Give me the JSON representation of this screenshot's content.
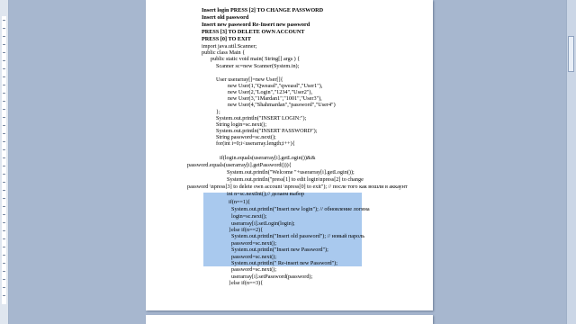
{
  "document": {
    "lines": [
      {
        "text": "Insert login PRESS [2] TO CHANGE PASSWORD",
        "bold": true
      },
      {
        "text": "Insert old password",
        "bold": true
      },
      {
        "text": "Insert new password Re-Insert new password",
        "bold": true
      },
      {
        "text": "PRESS [3] TO DELETE OWN ACCOUNT",
        "bold": true
      },
      {
        "text": "PRESS [0] TO EXIT",
        "bold": true
      },
      {
        "text": "import java.util.Scanner;",
        "bold": false
      },
      {
        "text": "public class Main {",
        "bold": false
      },
      {
        "text": "public static void main( String[] args ) {",
        "bold": false
      },
      {
        "text": "Scanner sc=new Scanner(System.in);",
        "bold": false
      },
      {
        "text": "User userarray[]=new User[]{",
        "bold": false
      },
      {
        "text": "new User(1,\"Qweasd\",\"qweasd\",\"User1\"),",
        "bold": false
      },
      {
        "text": "new User(2,\"Login\",\"1234\",\"User2\"),",
        "bold": false
      },
      {
        "text": "new User(3,\"1Mardan1\",\"1001\",\"User3\"),",
        "bold": false
      },
      {
        "text": "new User(4,\"Shahmardan\",\"password\",\"User4\")",
        "bold": false
      },
      {
        "text": "};",
        "bold": false
      },
      {
        "text": "System.out.println(\"INSERT LOGIN:\");",
        "bold": false
      },
      {
        "text": "String login=sc.next();",
        "bold": false
      },
      {
        "text": "System.out.println(\"INSERT PASSWORD\");",
        "bold": false
      },
      {
        "text": "String password=sc.next();",
        "bold": false
      },
      {
        "text": "for(int i=0;i<userarray.length;i++){",
        "bold": false
      },
      {
        "text": "if(login.equals(userarray[i].getLogin())&&",
        "bold": false
      },
      {
        "text": "password.equals(userarray[i].getPassword())){",
        "bold": false
      },
      {
        "text": "System.out.println(\"Welcome \"+userarray[i].getLogin());",
        "bold": false
      },
      {
        "text": "System.out.println(\"press[1] to edit login\\npress[2] to change",
        "bold": false
      },
      {
        "text": "password \\npress[3] to delete own account \\npress[0] to exit\"); // после того как вошли в аккаунт",
        "bold": false
      },
      {
        "text": "int n=sc.nextInt();// делаем выбор",
        "bold": false
      },
      {
        "text": "if(n==1){",
        "bold": false
      },
      {
        "text": "System.out.println(\"Insert new login\"); // обновление логина",
        "bold": false
      },
      {
        "text": "login=sc.next();",
        "bold": false
      },
      {
        "text": "userarray[i].setLogin(login);",
        "bold": false
      },
      {
        "text": "}else if(n==2){",
        "bold": false
      },
      {
        "text": "System.out.println(\"Insert old password\"); // новый пароль",
        "bold": false
      },
      {
        "text": "password=sc.next();",
        "bold": false
      },
      {
        "text": "System.out.println(\"Insert new Password\");",
        "bold": false
      },
      {
        "text": "password=sc.next();",
        "bold": false
      },
      {
        "text": "System.out.println(\" Re-insert new Password\");",
        "bold": false
      },
      {
        "text": "password=sc.next();",
        "bold": false
      },
      {
        "text": "userarray[i].setPassword(password);",
        "bold": false
      },
      {
        "text": "}else if(n==3){",
        "bold": false
      }
    ]
  },
  "colors": {
    "workspace": "#a7b7cf",
    "page": "#ffffff",
    "selection": "#a9c9ee"
  }
}
